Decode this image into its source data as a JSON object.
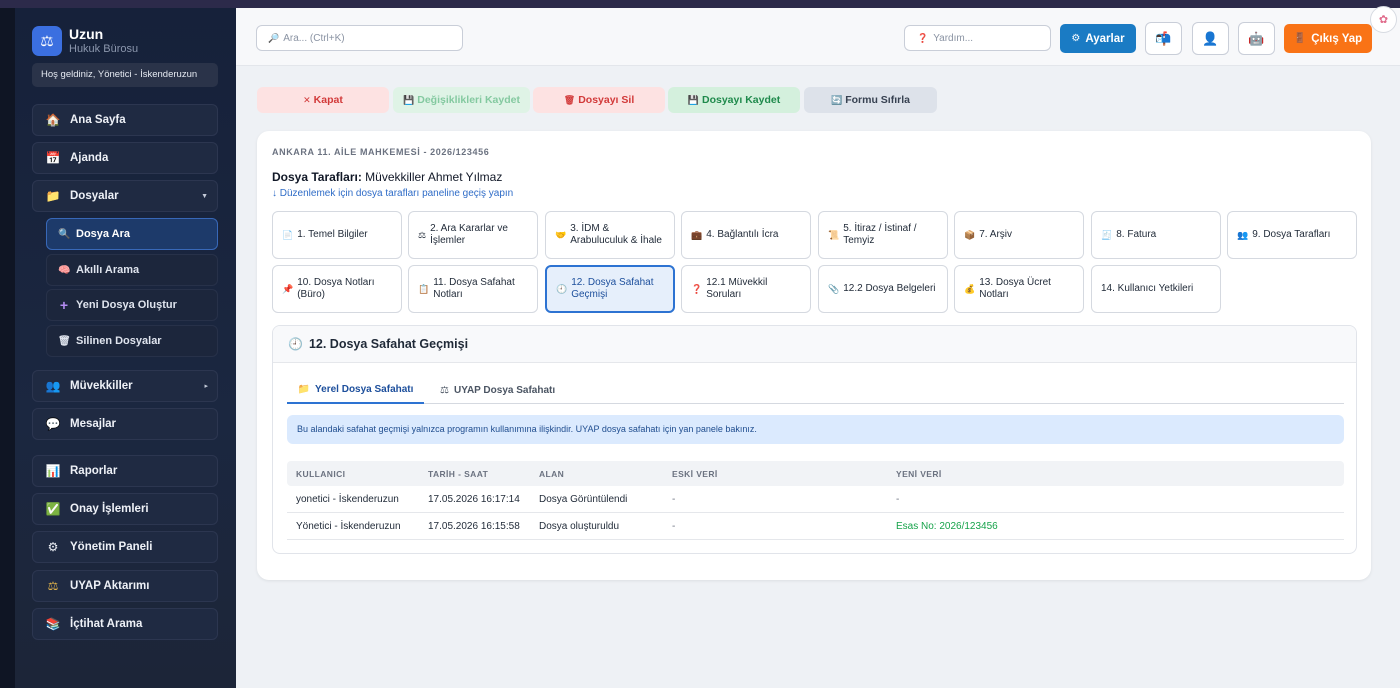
{
  "app": {
    "brand_name": "Uzun",
    "brand_sub": "Hukuk Bürosu",
    "welcome": "Hoş geldiniz, Yönetici - İskenderuzun"
  },
  "sidebar": {
    "items": [
      {
        "label": "Ana Sayfa",
        "icon": "🏠"
      },
      {
        "label": "Ajanda",
        "icon": "📅"
      },
      {
        "label": "Dosyalar",
        "icon": "📁",
        "caret": "▼"
      },
      {
        "label": "Müvekkiller",
        "icon": "👥",
        "caret": "▸"
      },
      {
        "label": "Mesajlar",
        "icon": "💬"
      },
      {
        "label": "Raporlar",
        "icon": "📊"
      },
      {
        "label": "Onay İşlemleri",
        "icon": "✅"
      },
      {
        "label": "Yönetim Paneli",
        "icon": "⚙"
      },
      {
        "label": "UYAP Aktarımı",
        "icon": "⚖"
      },
      {
        "label": "İçtihat Arama",
        "icon": "📚"
      }
    ],
    "sub_items": [
      {
        "label": "Dosya Ara",
        "icon": "🔍"
      },
      {
        "label": "Akıllı Arama",
        "icon": "🧠"
      },
      {
        "label": "Yeni Dosya Oluştur",
        "icon": "+"
      },
      {
        "label": "Silinen Dosyalar",
        "icon": "🗑"
      }
    ]
  },
  "topbar": {
    "search_placeholder": "Ara... (Ctrl+K)",
    "search_icon": "🔎",
    "help_placeholder": "Yardım...",
    "help_icon": "❓",
    "settings_label": "Ayarlar",
    "settings_icon": "⚙",
    "notif_icon": "📬",
    "user_icon": "👤",
    "bot_icon": "🤖",
    "logout_label": "Çıkış Yap",
    "logout_icon": "🚪",
    "corner_icon": "✿"
  },
  "actions": [
    {
      "label": "Kapat",
      "icon": "✕"
    },
    {
      "label": "Değişiklikleri Kaydet",
      "icon": "💾"
    },
    {
      "label": "Dosyayı Sil",
      "icon": "🗑"
    },
    {
      "label": "Dosyayı Kaydet",
      "icon": "💾"
    },
    {
      "label": "Formu Sıfırla",
      "icon": "🔄"
    }
  ],
  "file": {
    "court": "ANKARA 11. AİLE MAHKEMESİ - 2026/123456",
    "parties_label": "Dosya Tarafları:",
    "parties_value": "Müvekkiller Ahmet Yılmaz",
    "edit_hint": "↓ Düzenlemek için dosya tarafları paneline geçiş yapın"
  },
  "tabs": [
    {
      "label": "1. Temel Bilgiler",
      "icon": "📄"
    },
    {
      "label": "2. Ara Kararlar ve İşlemler",
      "icon": "⚖"
    },
    {
      "label": "3. İDM & Arabuluculuk & İhale",
      "icon": "🤝"
    },
    {
      "label": "4. Bağlantılı İcra",
      "icon": "💼"
    },
    {
      "label": "5. İtiraz / İstinaf / Temyiz",
      "icon": "📜"
    },
    {
      "label": "7. Arşiv",
      "icon": "📦"
    },
    {
      "label": "8. Fatura",
      "icon": "🧾"
    },
    {
      "label": "9. Dosya Tarafları",
      "icon": "👥"
    },
    {
      "label": "10. Dosya Notları (Büro)",
      "icon": "📌"
    },
    {
      "label": "11. Dosya Safahat Notları",
      "icon": "📋"
    },
    {
      "label": "12. Dosya Safahat Geçmişi",
      "icon": "🕘"
    },
    {
      "label": "12.1 Müvekkil Soruları",
      "icon": "❓"
    },
    {
      "label": "12.2 Dosya Belgeleri",
      "icon": "📎"
    },
    {
      "label": "13. Dosya Ücret Notları",
      "icon": "💰"
    },
    {
      "label": "14. Kullanıcı Yetkileri",
      "icon": ""
    }
  ],
  "panel": {
    "title": "12. Dosya Safahat Geçmişi",
    "title_icon": "🕘",
    "subtabs": [
      {
        "label": "Yerel Dosya Safahatı",
        "icon": "📁"
      },
      {
        "label": "UYAP Dosya Safahatı",
        "icon": "⚖"
      }
    ],
    "info": "Bu alandaki safahat geçmişi yalnızca programın kullanımına ilişkindir. UYAP dosya safahatı için yan panele bakınız.",
    "columns": [
      "KULLANICI",
      "TARİH - SAAT",
      "ALAN",
      "ESKİ VERİ",
      "YENİ VERİ"
    ],
    "rows": [
      [
        "yonetici - İskenderuzun",
        "17.05.2026 16:17:14",
        "Dosya Görüntülendi",
        "-",
        "-"
      ],
      [
        "Yönetici - İskenderuzun",
        "17.05.2026 16:15:58",
        "Dosya oluşturuldu",
        "-",
        "Esas No: 2026/123456"
      ]
    ]
  }
}
